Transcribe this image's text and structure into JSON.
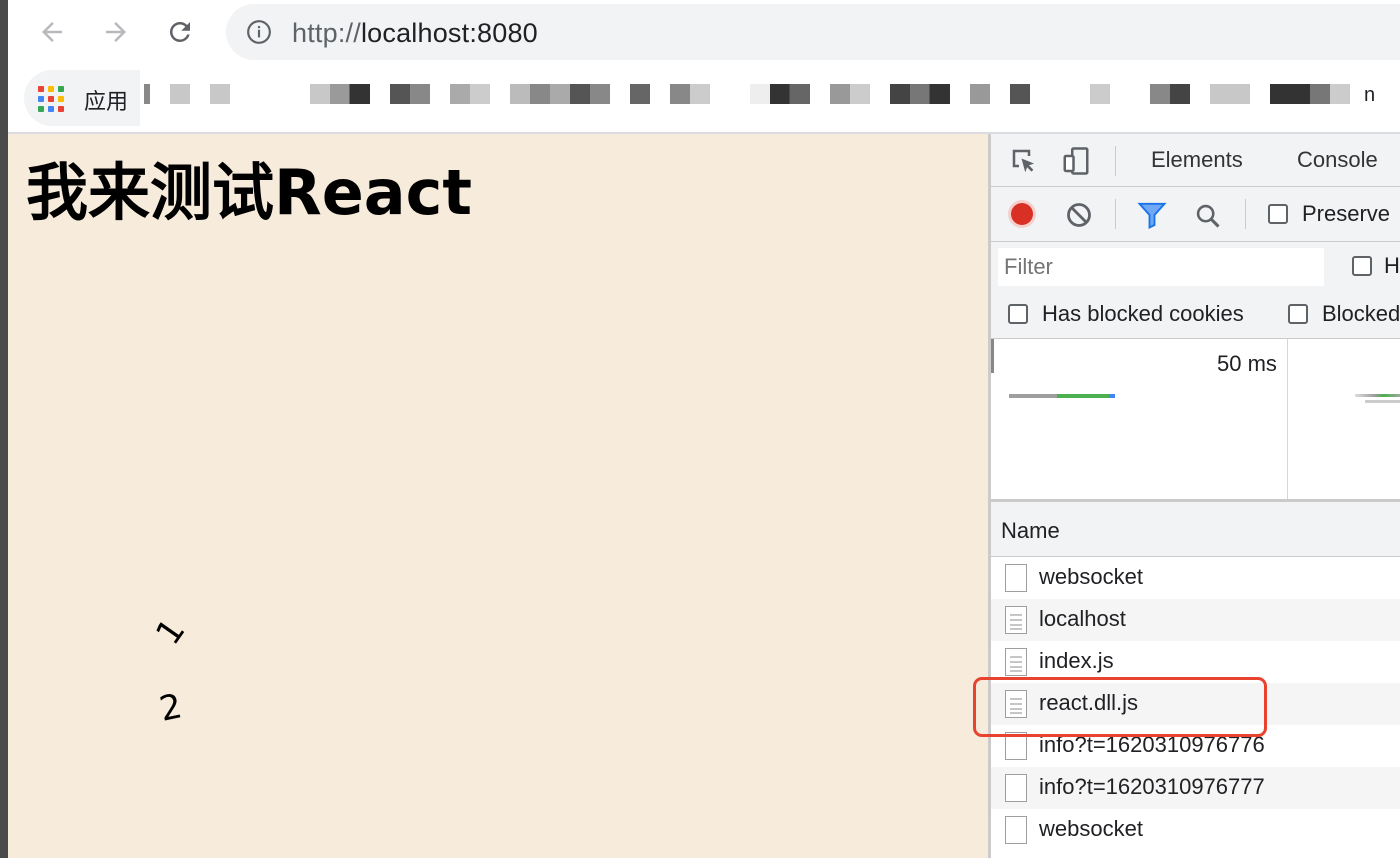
{
  "browser": {
    "url_scheme": "http://",
    "url_host": "localhost:8080",
    "bookmarks": {
      "apps_label": "应用",
      "tail_text": "n",
      "colors": {
        "apps_red": "#ea4335",
        "apps_blue": "#4285f4",
        "apps_green": "#34a853",
        "apps_yellow": "#fbbc05"
      }
    }
  },
  "page": {
    "title": "我来测试React",
    "numbers": [
      "1",
      "2"
    ],
    "background": "#f7ebdc"
  },
  "devtools": {
    "tabs": [
      "Elements",
      "Console"
    ],
    "toolbar": {
      "preserve_label": "Preserve",
      "record_color": "#d93025"
    },
    "filter": {
      "placeholder": "Filter",
      "hide_label": "H"
    },
    "cookie_filters": [
      "Has blocked cookies",
      "Blocked"
    ],
    "overview": {
      "tick_label": "50 ms"
    },
    "name_header": "Name",
    "requests": [
      {
        "name": "websocket",
        "icon": "blank-file-icon"
      },
      {
        "name": "localhost",
        "icon": "document-icon"
      },
      {
        "name": "index.js",
        "icon": "document-icon"
      },
      {
        "name": "react.dll.js",
        "icon": "document-icon"
      },
      {
        "name": "info?t=1620310976776",
        "icon": "blank-file-icon"
      },
      {
        "name": "info?t=1620310976777",
        "icon": "blank-file-icon"
      },
      {
        "name": "websocket",
        "icon": "blank-file-icon"
      }
    ],
    "highlight_color": "#e8432e"
  }
}
